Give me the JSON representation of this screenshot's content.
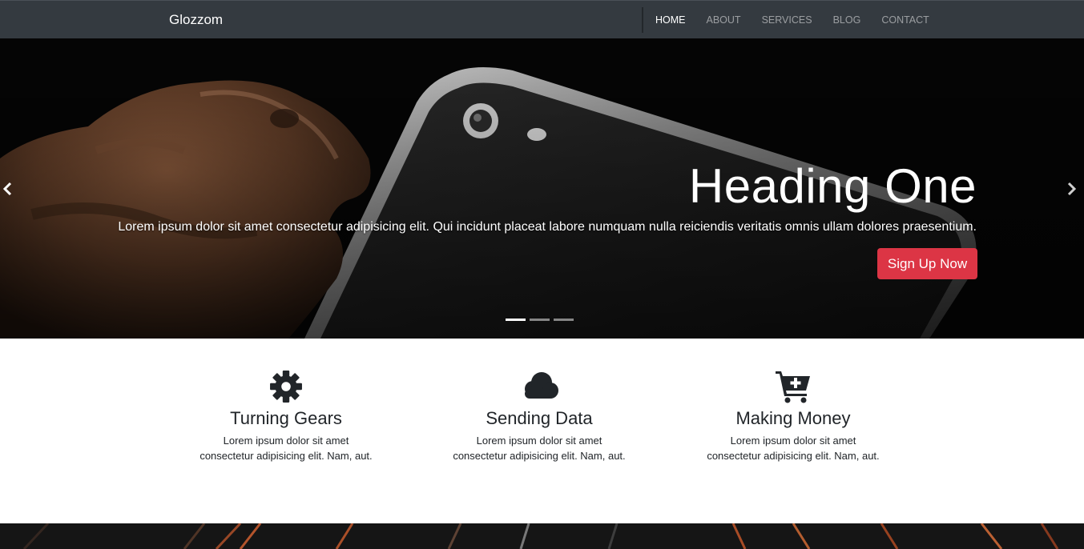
{
  "navbar": {
    "brand": "Glozzom",
    "links": [
      {
        "label": "HOME",
        "active": true
      },
      {
        "label": "ABOUT",
        "active": false
      },
      {
        "label": "SERVICES",
        "active": false
      },
      {
        "label": "BLOG",
        "active": false
      },
      {
        "label": "CONTACT",
        "active": false
      }
    ]
  },
  "hero": {
    "title": "Heading One",
    "text": "Lorem ipsum dolor sit amet consectetur adipisicing elit. Qui incidunt placeat labore numquam nulla reiciendis veritatis omnis ullam dolores praesentium.",
    "button_label": "Sign Up Now",
    "prev_icon": "chevron-left-icon",
    "next_icon": "chevron-right-icon",
    "slides_count": 3,
    "active_slide": 1
  },
  "features": [
    {
      "icon": "gear-icon",
      "title": "Turning Gears",
      "text": "Lorem ipsum dolor sit amet consectetur adipisicing elit. Nam, aut."
    },
    {
      "icon": "cloud-icon",
      "title": "Sending Data",
      "text": "Lorem ipsum dolor sit amet consectetur adipisicing elit. Nam, aut."
    },
    {
      "icon": "cart-plus-icon",
      "title": "Making Money",
      "text": "Lorem ipsum dolor sit amet consectetur adipisicing elit. Nam, aut."
    }
  ],
  "colors": {
    "navbar_bg": "#343a40",
    "accent": "#dc3545",
    "text_dark": "#212529"
  }
}
